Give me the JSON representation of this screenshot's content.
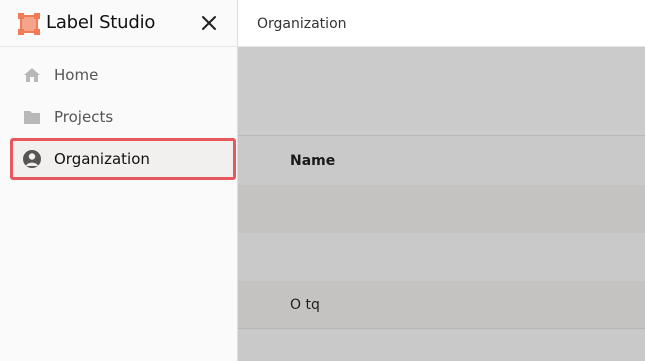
{
  "app": {
    "brand_name": "Label Studio",
    "accent_color": "#e8575b",
    "logo_color": "#f07b55"
  },
  "sidebar": {
    "items": [
      {
        "label": "Home",
        "icon": "home-icon",
        "active": false
      },
      {
        "label": "Projects",
        "icon": "folder-icon",
        "active": false
      },
      {
        "label": "Organization",
        "icon": "user-avatar-icon",
        "active": true
      }
    ]
  },
  "header": {
    "breadcrumb": "Organization"
  },
  "table": {
    "columns": [
      "Name"
    ],
    "rows": [
      {
        "name": ""
      },
      {
        "name": ""
      },
      {
        "name": "O tq"
      },
      {
        "name": ""
      }
    ]
  }
}
